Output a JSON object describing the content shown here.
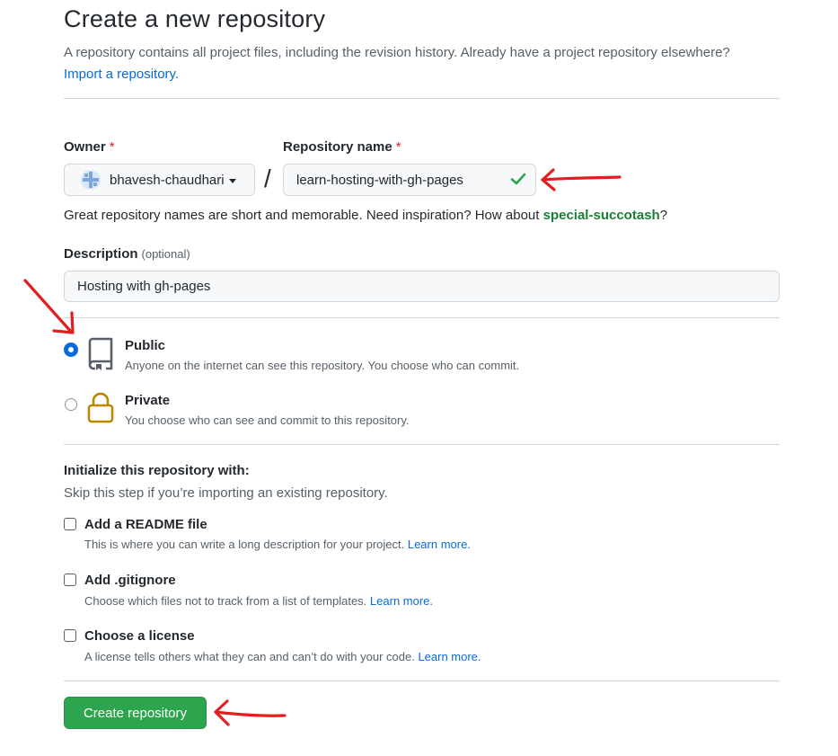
{
  "header": {
    "title": "Create a new repository",
    "subtitle": "A repository contains all project files, including the revision history. Already have a project repository elsewhere?",
    "import_link": "Import a repository."
  },
  "owner": {
    "label": "Owner",
    "required_mark": "*",
    "value": "bhavesh-chaudhari"
  },
  "separator": "/",
  "repo_name": {
    "label": "Repository name",
    "required_mark": "*",
    "value": "learn-hosting-with-gh-pages"
  },
  "hint": {
    "text": "Great repository names are short and memorable. Need inspiration? How about ",
    "suggestion": "special-succotash",
    "suffix": "?"
  },
  "description": {
    "label": "Description",
    "optional": "(optional)",
    "value": "Hosting with gh-pages"
  },
  "visibility": {
    "selected": "public",
    "public": {
      "title": "Public",
      "subtitle": "Anyone on the internet can see this repository. You choose who can commit.",
      "icon": "repo-icon"
    },
    "private": {
      "title": "Private",
      "subtitle": "You choose who can see and commit to this repository.",
      "icon": "lock-icon"
    }
  },
  "initialize": {
    "title": "Initialize this repository with:",
    "subtitle": "Skip this step if you’re importing an existing repository.",
    "options": [
      {
        "title": "Add a README file",
        "desc": "This is where you can write a long description for your project. ",
        "link": "Learn more.",
        "checked": false
      },
      {
        "title": "Add .gitignore",
        "desc": "Choose which files not to track from a list of templates. ",
        "link": "Learn more.",
        "checked": false
      },
      {
        "title": "Choose a license",
        "desc": "A license tells others what they can and can’t do with your code. ",
        "link": "Learn more.",
        "checked": false
      }
    ]
  },
  "create_button": "Create repository",
  "colors": {
    "primary_button": "#2da44e",
    "link": "#0969da",
    "suggestion": "#1a7f37",
    "required": "#cf222e",
    "annotation_arrow": "#e02020"
  }
}
